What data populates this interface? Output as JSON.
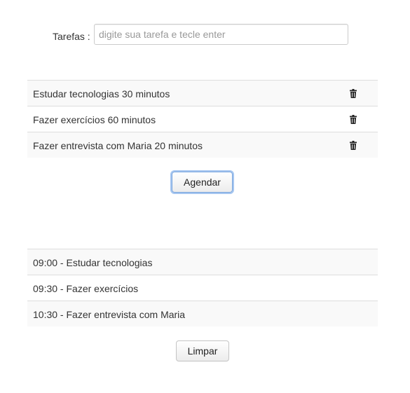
{
  "form": {
    "label": "Tarefas :",
    "input_value": "",
    "input_placeholder": "digite sua tarefa e tecle enter"
  },
  "tasks": [
    {
      "text": "Estudar tecnologias 30 minutos",
      "icon": "trash-icon"
    },
    {
      "text": "Fazer exercícios 60 minutos",
      "icon": "trash-icon"
    },
    {
      "text": "Fazer entrevista com Maria 20 minutos",
      "icon": "trash-icon"
    }
  ],
  "buttons": {
    "schedule_label": "Agendar",
    "clear_label": "Limpar"
  },
  "schedule": [
    {
      "text": "09:00 - Estudar tecnologias"
    },
    {
      "text": "09:30 - Fazer exercícios"
    },
    {
      "text": "10:30 - Fazer entrevista com Maria"
    }
  ],
  "colors": {
    "row_stripe": "#f9f9f9",
    "row_border": "#dddddd",
    "focus_ring": "#a6c6f0"
  }
}
